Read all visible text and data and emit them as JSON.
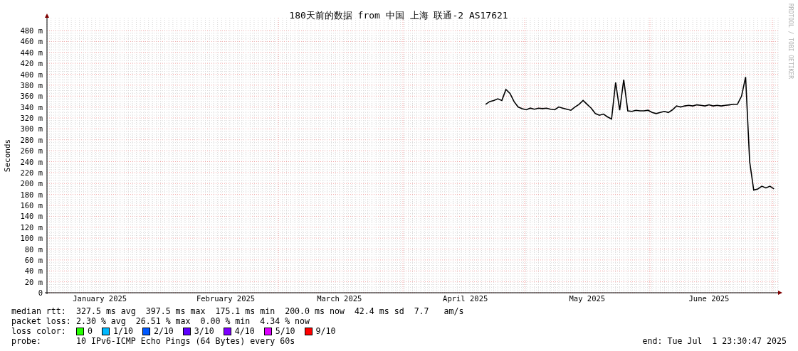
{
  "chart_data": {
    "type": "line",
    "grid": true,
    "title": "180天前的数据 from 中国 上海 联通-2 AS17621",
    "ylabel": "Seconds",
    "ylim": [
      0,
      480
    ],
    "categories": [
      null,
      null,
      null,
      null,
      null,
      null,
      null,
      null,
      null,
      null,
      null,
      null,
      null,
      "January 2025",
      null,
      null,
      null,
      null,
      null,
      null,
      null,
      null,
      null,
      null,
      null,
      null,
      null,
      null,
      null,
      null,
      null,
      null,
      null,
      null,
      null,
      null,
      null,
      null,
      null,
      null,
      null,
      null,
      null,
      null,
      "February 2025",
      null,
      null,
      null,
      null,
      null,
      null,
      null,
      null,
      null,
      null,
      null,
      null,
      null,
      null,
      null,
      null,
      null,
      null,
      null,
      null,
      null,
      null,
      null,
      null,
      null,
      null,
      null,
      "March 2025",
      null,
      null,
      null,
      null,
      null,
      null,
      null,
      null,
      null,
      null,
      null,
      null,
      null,
      null,
      null,
      null,
      null,
      null,
      null,
      null,
      null,
      null,
      null,
      null,
      null,
      null,
      null,
      null,
      null,
      null,
      "April 2025",
      null,
      null,
      null,
      null,
      null,
      null,
      null,
      null,
      null,
      null,
      null,
      null,
      null,
      null,
      null,
      null,
      null,
      null,
      null,
      null,
      null,
      null,
      null,
      null,
      null,
      null,
      null,
      null,
      null,
      "May 2025",
      null,
      null,
      null,
      null,
      null,
      null,
      null,
      null,
      null,
      null,
      null,
      null,
      null,
      null,
      null,
      null,
      null,
      null,
      null,
      null,
      null,
      null,
      null,
      null,
      null,
      null,
      null,
      null,
      null,
      "June 2025",
      null,
      null,
      null,
      null,
      null,
      null,
      null,
      null,
      null,
      null,
      null,
      null,
      null,
      null,
      null,
      null
    ],
    "yticks": [
      {
        "value": 0,
        "label": "0"
      },
      {
        "value": 20,
        "label": "20 m"
      },
      {
        "value": 40,
        "label": "40 m"
      },
      {
        "value": 60,
        "label": "60 m"
      },
      {
        "value": 80,
        "label": "80 m"
      },
      {
        "value": 100,
        "label": "100 m"
      },
      {
        "value": 120,
        "label": "120 m"
      },
      {
        "value": 140,
        "label": "140 m"
      },
      {
        "value": 160,
        "label": "160 m"
      },
      {
        "value": 180,
        "label": "180 m"
      },
      {
        "value": 200,
        "label": "200 m"
      },
      {
        "value": 220,
        "label": "220 m"
      },
      {
        "value": 240,
        "label": "240 m"
      },
      {
        "value": 260,
        "label": "260 m"
      },
      {
        "value": 280,
        "label": "280 m"
      },
      {
        "value": 300,
        "label": "300 m"
      },
      {
        "value": 320,
        "label": "320 m"
      },
      {
        "value": 340,
        "label": "340 m"
      },
      {
        "value": 360,
        "label": "360 m"
      },
      {
        "value": 380,
        "label": "380 m"
      },
      {
        "value": 400,
        "label": "400 m"
      },
      {
        "value": 420,
        "label": "420 m"
      },
      {
        "value": 440,
        "label": "440 m"
      },
      {
        "value": 460,
        "label": "460 m"
      },
      {
        "value": 480,
        "label": "480 m"
      }
    ],
    "series": [
      {
        "name": "median rtt:",
        "color": "#000000",
        "values": [
          null,
          null,
          null,
          null,
          null,
          null,
          null,
          null,
          null,
          null,
          null,
          null,
          null,
          null,
          null,
          null,
          null,
          null,
          null,
          null,
          null,
          null,
          null,
          null,
          null,
          null,
          null,
          null,
          null,
          null,
          null,
          null,
          null,
          null,
          null,
          null,
          null,
          null,
          null,
          null,
          null,
          null,
          null,
          null,
          null,
          null,
          null,
          null,
          null,
          null,
          null,
          null,
          null,
          null,
          null,
          null,
          null,
          null,
          null,
          null,
          null,
          null,
          null,
          null,
          null,
          null,
          null,
          null,
          null,
          null,
          null,
          null,
          null,
          null,
          null,
          null,
          null,
          null,
          null,
          null,
          null,
          null,
          null,
          null,
          null,
          null,
          null,
          null,
          null,
          null,
          null,
          null,
          null,
          null,
          null,
          null,
          null,
          null,
          null,
          null,
          null,
          null,
          null,
          null,
          null,
          null,
          null,
          null,
          345,
          350,
          352,
          355,
          352,
          372,
          365,
          350,
          340,
          337,
          335,
          338,
          336,
          338,
          337,
          338,
          336,
          335,
          340,
          338,
          336,
          334,
          340,
          345,
          352,
          345,
          338,
          328,
          325,
          327,
          322,
          318,
          385,
          334,
          390,
          333,
          332,
          334,
          333,
          333,
          334,
          330,
          328,
          330,
          332,
          330,
          335,
          342,
          340,
          342,
          343,
          342,
          344,
          343,
          342,
          344,
          342,
          343,
          342,
          343,
          344,
          345,
          345,
          360,
          395,
          240,
          188,
          190,
          195,
          192,
          195,
          190
        ]
      }
    ]
  },
  "credit": "RRDTOOL / TOBI OETIKER",
  "legend": {
    "median_rtt": {
      "text": "327.5 ms avg  397.5 ms max  175.1 ms min  200.0 ms now  42.4 ms sd  7.7   am/s"
    },
    "stats": [
      {
        "label": "packet loss:",
        "text": "2.30 % avg  26.51 % max  0.00 % min  4.34 % now"
      }
    ],
    "loss_color": {
      "label": "loss color:",
      "items": [
        {
          "label": "0",
          "color": "#26ff00"
        },
        {
          "label": "1/10",
          "color": "#00b8ff"
        },
        {
          "label": "2/10",
          "color": "#0059ff"
        },
        {
          "label": "3/10",
          "color": "#5e00ff"
        },
        {
          "label": "4/10",
          "color": "#7e00ff"
        },
        {
          "label": "5/10",
          "color": "#dd00ff"
        },
        {
          "label": "9/10",
          "color": "#ff0000"
        }
      ]
    },
    "probe": {
      "label": "probe:",
      "text": "10 IPv6-ICMP Echo Pings (64 Bytes) every 60s",
      "end": "end: Tue Jul  1 23:30:47 2025"
    }
  }
}
